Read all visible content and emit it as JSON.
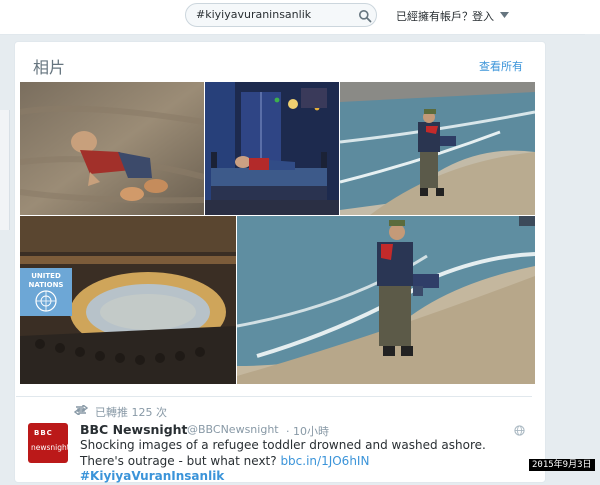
{
  "topbar": {
    "search_value": "#kiyiyavuraninsanlik",
    "account_question": "已經擁有帳戶？",
    "login_label": "登入"
  },
  "photos_panel": {
    "title": "相片",
    "view_all": "查看所有",
    "photos": [
      {
        "id": "drawing",
        "alt": "illustration"
      },
      {
        "id": "night",
        "alt": "night bedroom illustration"
      },
      {
        "id": "beach-top",
        "alt": "beach photo"
      },
      {
        "id": "un",
        "alt": "UN council chamber"
      },
      {
        "id": "beach-large",
        "alt": "beach photo large"
      }
    ],
    "un_badge": {
      "line1": "UNITED",
      "line2": "NATIONS"
    }
  },
  "tweet": {
    "retweet_text": "已轉推 125 次",
    "avatar": {
      "line1": "BBC",
      "line2": "newsnight"
    },
    "name": "BBC Newsnight",
    "handle": "@BBCNewsnight",
    "time": "· 10小時",
    "text_main": "Shocking images of a refugee toddler drowned and washed ashore. There's outrage - but what next? ",
    "link": "bbc.in/1JO6hIN",
    "hashtag": " #KiyiyaVuranInsanlik"
  },
  "date_stamp": "2015年9月3日",
  "colors": {
    "link_blue": "#3b94d9",
    "bbc_red": "#bb1919",
    "muted": "#8899a6"
  },
  "icons": [
    "search-icon",
    "caret-down-icon",
    "retweet-icon",
    "globe-icon"
  ]
}
